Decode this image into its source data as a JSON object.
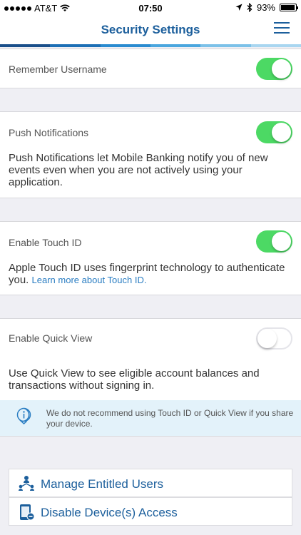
{
  "status_bar": {
    "carrier": "AT&T",
    "time": "07:50",
    "battery": "93%",
    "battery_level": 0.93
  },
  "header": {
    "title": "Security Settings",
    "accent_colors": [
      "#1a4f8a",
      "#1c6fb5",
      "#2a8bd0",
      "#4aa6de",
      "#7cc1e8",
      "#a9d6f0"
    ]
  },
  "settings": {
    "remember_username": {
      "label": "Remember Username",
      "enabled": true
    },
    "push_notifications": {
      "label": "Push Notifications",
      "enabled": true,
      "description": "Push Notifications let Mobile Banking notify you of new events even when you are not actively using your application."
    },
    "touch_id": {
      "label": "Enable Touch ID",
      "enabled": true,
      "description": "Apple Touch ID uses fingerprint technology to authenticate you.",
      "link": "Learn more about Touch ID."
    },
    "quick_view": {
      "label": "Enable Quick View",
      "enabled": false,
      "description": "Use Quick View to see eligible account balances and transactions without signing in."
    }
  },
  "info_notice": "We do not recommend using Touch ID or Quick View if you share your device.",
  "actions": {
    "manage_users": "Manage Entitled Users",
    "disable_devices": "Disable Device(s) Access"
  },
  "colors": {
    "toggle_on": "#4cd964",
    "brand_blue": "#1c5f9c",
    "info_bg": "#e3f2fa"
  }
}
